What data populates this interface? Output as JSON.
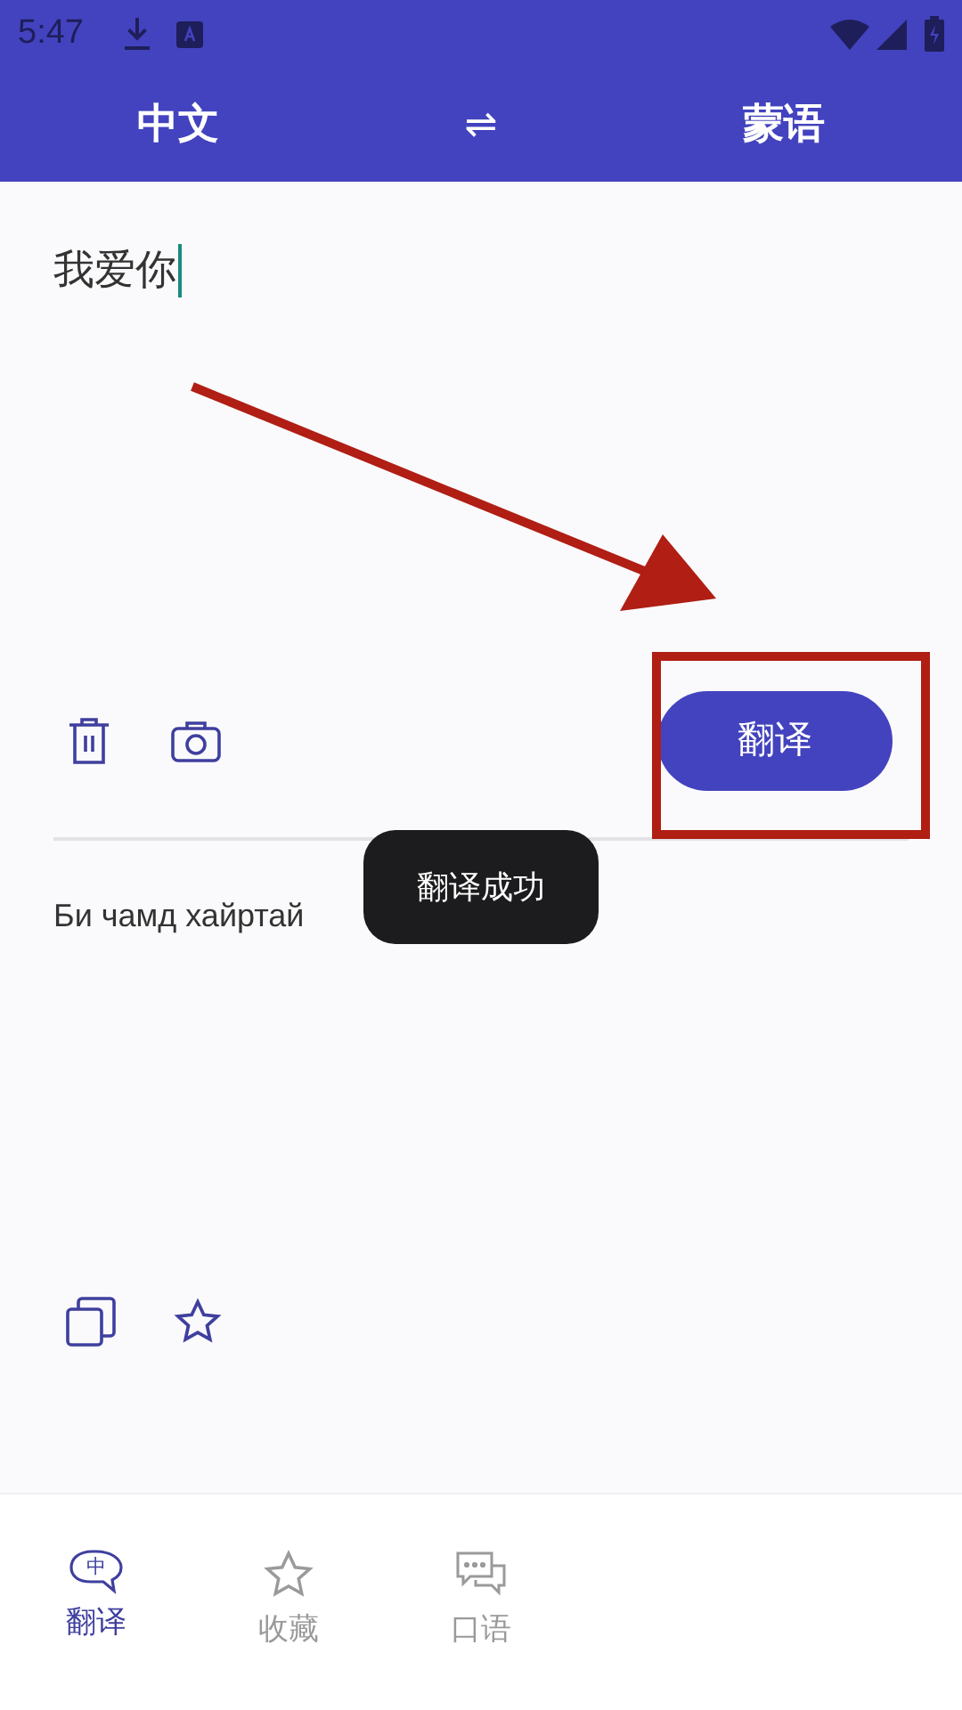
{
  "status_bar": {
    "time": "5:47"
  },
  "header": {
    "source_language": "中文",
    "swap": "⇌",
    "target_language": "蒙语"
  },
  "input": {
    "value": "我爱你"
  },
  "translate_button": {
    "label": "翻译"
  },
  "output": {
    "text": "Би чамд хайртай"
  },
  "toast": {
    "text": "翻译成功"
  },
  "bottom_nav": [
    {
      "kind": "translate",
      "label": "翻译",
      "icon_text": "中",
      "selected": true
    },
    {
      "kind": "favorites",
      "label": "收藏",
      "selected": false
    },
    {
      "kind": "speech",
      "label": "口语",
      "selected": false
    }
  ]
}
